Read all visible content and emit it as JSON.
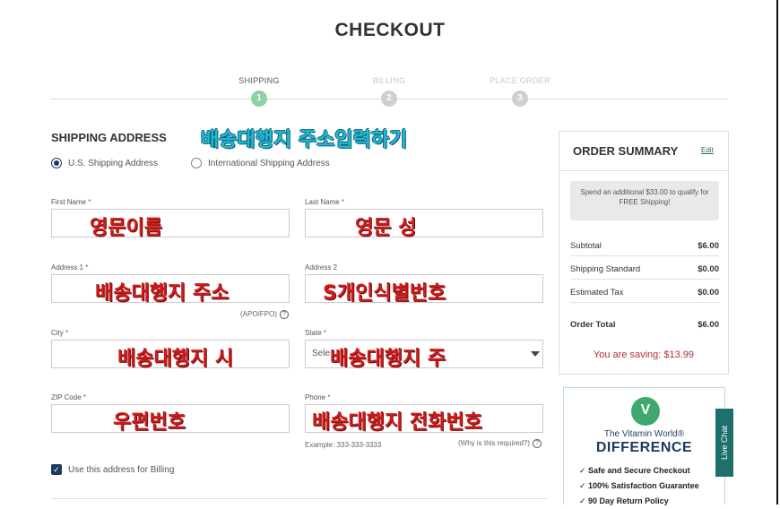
{
  "page_title": "CHECKOUT",
  "steps": [
    {
      "label": "SHIPPING",
      "number": "1",
      "active": true
    },
    {
      "label": "BILLING",
      "number": "2",
      "active": false
    },
    {
      "label": "PLACE ORDER",
      "number": "3",
      "active": false
    }
  ],
  "shipping": {
    "title": "SHIPPING ADDRESS",
    "overlay_title": "배송대행지 주소입력하기",
    "radio_us": "U.S. Shipping Address",
    "radio_intl": "International Shipping Address",
    "fields": {
      "first_name": {
        "label": "First Name",
        "overlay": "영문이름"
      },
      "last_name": {
        "label": "Last Name",
        "overlay": "영문 성"
      },
      "address1": {
        "label": "Address 1",
        "overlay": "배송대행지 주소",
        "helper": "(APO/FPO)"
      },
      "address2": {
        "label": "Address 2",
        "overlay": "S개인식별번호"
      },
      "city": {
        "label": "City",
        "overlay": "배송대행지 시"
      },
      "state": {
        "label": "State",
        "value": "Sele",
        "overlay": "배송대행지 주"
      },
      "zip": {
        "label": "ZIP Code",
        "overlay": "우편번호"
      },
      "phone": {
        "label": "Phone",
        "overlay": "배송대행지 전화번호",
        "example": "Example: 333-333-3333",
        "why": "(Why is this required?)"
      }
    },
    "billing_checkbox": "Use this address for Billing"
  },
  "summary": {
    "title": "ORDER SUMMARY",
    "edit": "Edit",
    "promo": "Spend an additional $33.00 to qualify for FREE Shipping!",
    "rows": [
      {
        "label": "Subtotal",
        "value": "$6.00"
      },
      {
        "label": "Shipping Standard",
        "value": "$0.00"
      },
      {
        "label": "Estimated Tax",
        "value": "$0.00"
      }
    ],
    "total": {
      "label": "Order Total",
      "value": "$6.00"
    },
    "saving": "You are saving: $13.99"
  },
  "vitamin_world": {
    "brand": "The Vitamin World®",
    "headline": "DIFFERENCE",
    "bullets": [
      "✓ Safe and Secure Checkout",
      "✓ 100% Satisfaction Guarantee",
      "✓ 90 Day Return Policy"
    ]
  },
  "live_chat": "Live Chat",
  "required_marker": "*",
  "help_glyph": "?",
  "check_glyph": "✓",
  "logo_glyph": "V",
  "colors": {
    "accent_green": "#8fd1a6",
    "navy": "#1e3a5f",
    "overlay_red": "#ce1b1b",
    "overlay_blue": "#22b8d4"
  }
}
